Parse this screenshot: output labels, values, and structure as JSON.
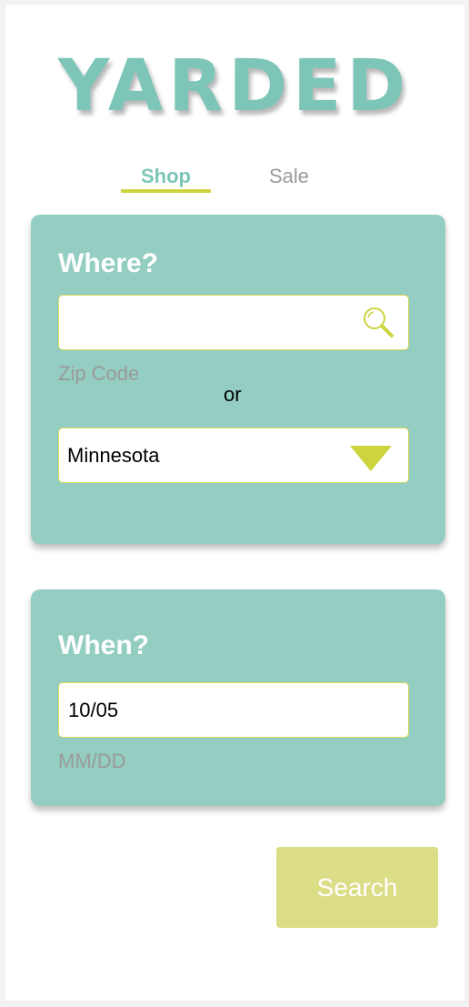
{
  "app": {
    "logo": "YARDED"
  },
  "tabs": {
    "shop": "Shop",
    "sale": "Sale",
    "active": "shop"
  },
  "where_card": {
    "title": "Where?",
    "zip_input": {
      "value": "",
      "hint": "Zip Code"
    },
    "or_label": "or",
    "state_select": {
      "selected": "Minnesota"
    }
  },
  "when_card": {
    "title": "When?",
    "date_input": {
      "value": "10/05",
      "hint": "MM/DD"
    }
  },
  "actions": {
    "search_label": "Search"
  },
  "icons": {
    "search": "magnifier-icon",
    "dropdown": "triangle-down-icon"
  },
  "colors": {
    "brand_teal": "#7cc5b7",
    "card_teal": "#94cdc2",
    "accent_lime": "#cdd43e",
    "button_lime": "#dcdd87",
    "muted_text": "#9a9a9a"
  }
}
